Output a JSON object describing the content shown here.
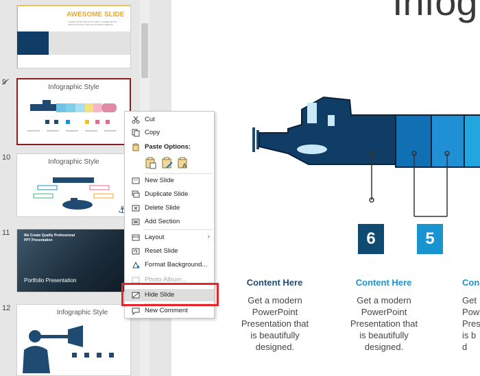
{
  "thumbnails": [
    {
      "num": "",
      "title": "AWESOME SLIDE",
      "body": "LOREM IPSUM DOLOR SIT AMET, CONSECTETUR ADIPISCING ELIT, SED DO EIUSMOD TEMPOR"
    },
    {
      "num": "9",
      "title": "Infographic Style",
      "selected": true
    },
    {
      "num": "10",
      "title": "Infographic Style"
    },
    {
      "num": "11",
      "title": "We Create Quality Professional PPT Presentation",
      "footer": "Portfolio Presentation"
    },
    {
      "num": "12",
      "title": "Infographic Style"
    }
  ],
  "main": {
    "title": "Infog",
    "boxes": [
      {
        "label": "6",
        "color": "#0f4a73"
      },
      {
        "label": "5",
        "color": "#1a93d1"
      }
    ],
    "columns": [
      {
        "heading": "Content  Here",
        "color": "#1f4b73",
        "body": [
          "Get a modern",
          "PowerPoint",
          "Presentation that",
          "is beautifully",
          "designed."
        ]
      },
      {
        "heading": "Content  Here",
        "color": "#1a93d1",
        "body": [
          "Get a modern",
          "PowerPoint",
          "Presentation that",
          "is beautifully",
          "designed."
        ]
      },
      {
        "heading": "Con",
        "color": "#1a93d1",
        "body": [
          "Get",
          "Pow",
          "Prese",
          "is b",
          "d"
        ]
      }
    ]
  },
  "context_menu": {
    "cut": "Cut",
    "copy": "Copy",
    "paste_options": "Paste Options:",
    "new_slide": "New Slide",
    "duplicate_slide": "Duplicate Slide",
    "delete_slide": "Delete Slide",
    "add_section": "Add Section",
    "layout": "Layout",
    "reset_slide": "Reset Slide",
    "format_background": "Format Background...",
    "photo_album": "Photo Album...",
    "hide_slide": "Hide Slide",
    "new_comment": "New Comment"
  },
  "colors": {
    "accent_red": "#e8242b",
    "selected_border": "#8a1c20",
    "dark_blue": "#0f4a73",
    "light_blue": "#1a93d1",
    "title_orange": "#f3a81e"
  }
}
